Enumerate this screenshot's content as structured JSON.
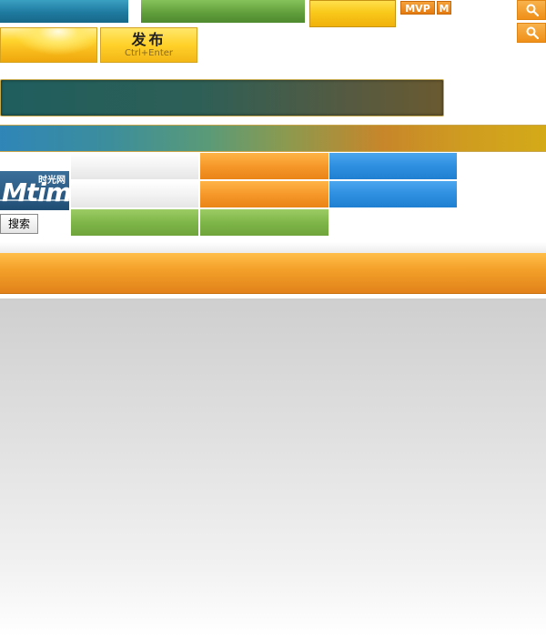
{
  "badges": {
    "mvp": "MVP",
    "m": "M"
  },
  "publish_button": {
    "label": "发布",
    "shortcut": "Ctrl+Enter"
  },
  "logo": {
    "word": "Mtime",
    "chinese": "时光网"
  },
  "search_button": {
    "label": "搜索"
  },
  "icons": {
    "search_top": "search-icon",
    "search_second": "search-icon"
  },
  "colors": {
    "accent_orange": "#f6982a",
    "accent_blue": "#2e8fe0",
    "accent_green": "#7fb649",
    "accent_yellow": "#ffd129",
    "teal": "#1f7aa0"
  }
}
